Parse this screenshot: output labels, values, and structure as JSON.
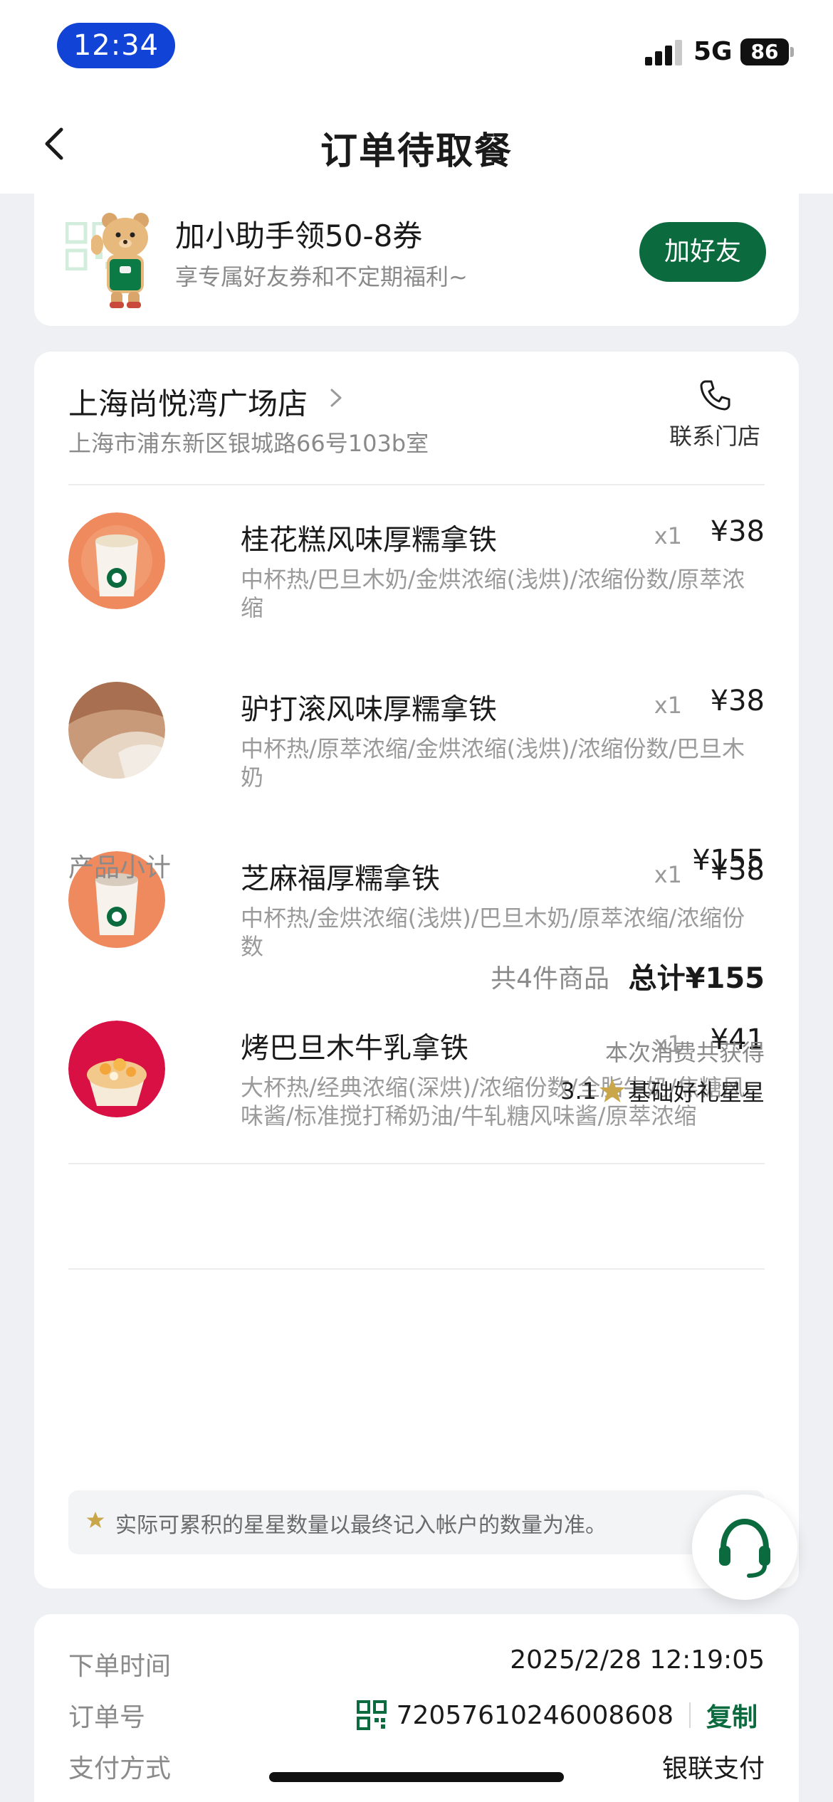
{
  "status_bar": {
    "time": "12:34",
    "network": "5G",
    "battery": "86"
  },
  "header": {
    "title": "订单待取餐"
  },
  "promo": {
    "title": "加小助手领50-8券",
    "subtitle": "享专属好友券和不定期福利~",
    "button": "加好友"
  },
  "store": {
    "name": "上海尚悦湾广场店",
    "address": "上海市浦东新区银城路66号103b室",
    "contact_label": "联系门店"
  },
  "items": [
    {
      "name": "桂花糕风味厚糯拿铁",
      "qty": "x1",
      "price": "¥38",
      "spec": "中杯热/巴旦木奶/金烘浓缩(浅烘)/浓缩份数/原萃浓缩"
    },
    {
      "name": "驴打滚风味厚糯拿铁",
      "qty": "x1",
      "price": "¥38",
      "spec": "中杯热/原萃浓缩/金烘浓缩(浅烘)/浓缩份数/巴旦木奶"
    },
    {
      "name": "芝麻福厚糯拿铁",
      "qty": "x1",
      "price": "¥38",
      "spec": "中杯热/金烘浓缩(浅烘)/巴旦木奶/原萃浓缩/浓缩份数"
    },
    {
      "name": "烤巴旦木牛乳拿铁",
      "qty": "x1",
      "price": "¥41",
      "spec": "大杯热/经典浓缩(深烘)/浓缩份数/全脂牛奶/焦糖风味酱/标准搅打稀奶油/牛轧糖风味酱/原萃浓缩"
    }
  ],
  "summary": {
    "subtotal_label": "产品小计",
    "subtotal_value": "¥155",
    "count_label": "共4件商品",
    "total_label": "总计¥155",
    "earn_label": "本次消费共获得",
    "earn_amount": "3.1",
    "earn_type": "基础好礼星星",
    "notice": "实际可累积的星星数量以最终记入帐户的数量为准。"
  },
  "order_info": {
    "time_label": "下单时间",
    "time_value": "2025/2/28 12:19:05",
    "number_label": "订单号",
    "number_value": "72057610246008608",
    "copy_label": "复制",
    "payment_label": "支付方式",
    "payment_value": "银联支付"
  },
  "colors": {
    "brand_green": "#0b6a3e",
    "time_pill_blue": "#1144d6",
    "star_gold": "#c9a64a"
  }
}
